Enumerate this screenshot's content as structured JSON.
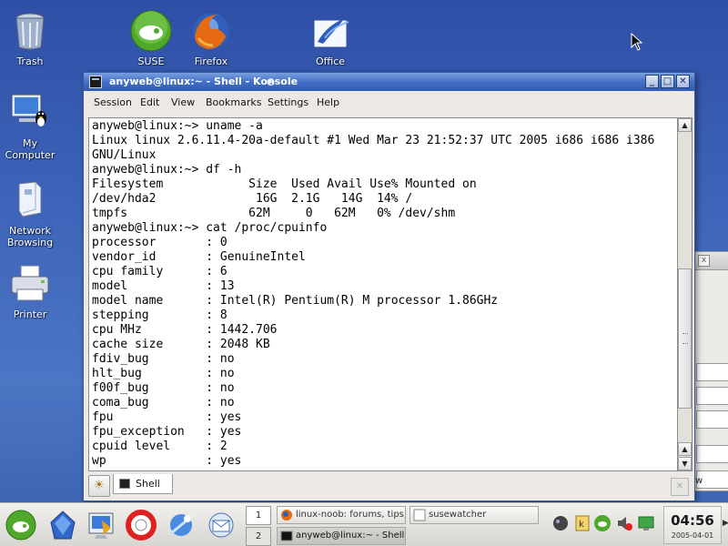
{
  "desktop": {
    "icons": [
      {
        "label": "Trash"
      },
      {
        "label": "SUSE"
      },
      {
        "label": "Firefox"
      },
      {
        "label": "Office"
      },
      {
        "label": "My\nComputer"
      },
      {
        "label": "Network\nBrowsing"
      },
      {
        "label": "Printer"
      }
    ]
  },
  "background_window": {
    "close_glyph": "x",
    "bottom_text": "w"
  },
  "konsole": {
    "title": "anyweb@linux:~ - Shell - Konsole",
    "menu": [
      "Session",
      "Edit",
      "View",
      "Bookmarks",
      "Settings",
      "Help"
    ],
    "terminal_lines": [
      "anyweb@linux:~> uname -a",
      "Linux linux 2.6.11.4-20a-default #1 Wed Mar 23 21:52:37 UTC 2005 i686 i686 i386",
      "GNU/Linux",
      "anyweb@linux:~> df -h",
      "Filesystem            Size  Used Avail Use% Mounted on",
      "/dev/hda2              16G  2.1G   14G  14% /",
      "tmpfs                 62M     0   62M   0% /dev/shm",
      "anyweb@linux:~> cat /proc/cpuinfo",
      "processor       : 0",
      "vendor_id       : GenuineIntel",
      "cpu family      : 6",
      "model           : 13",
      "model name      : Intel(R) Pentium(R) M processor 1.86GHz",
      "stepping        : 8",
      "cpu MHz         : 1442.706",
      "cache size      : 2048 KB",
      "fdiv_bug        : no",
      "hlt_bug         : no",
      "f00f_bug        : no",
      "coma_bug        : no",
      "fpu             : yes",
      "fpu_exception   : yes",
      "cpuid level     : 2",
      "wp              : yes"
    ],
    "tab_label": "Shell"
  },
  "taskbar": {
    "pager": [
      "1",
      "2"
    ],
    "tasks": [
      {
        "label": "linux-noob: forums, tips,"
      },
      {
        "label": "susewatcher"
      },
      {
        "label": "anyweb@linux:~ - Shell"
      }
    ],
    "clock_time": "04:56",
    "clock_date": "2005-04-01"
  },
  "colors": {
    "desktop_bg": "#3c63b8",
    "titlebar": "#3f6cc4",
    "suse_green": "#58b031"
  },
  "icons": [
    "trash-icon",
    "suse-icon",
    "firefox-icon",
    "office-icon",
    "computer-icon",
    "network-icon",
    "printer-icon",
    "konsole-icon",
    "new-tab-icon",
    "shell-tab-icon"
  ]
}
